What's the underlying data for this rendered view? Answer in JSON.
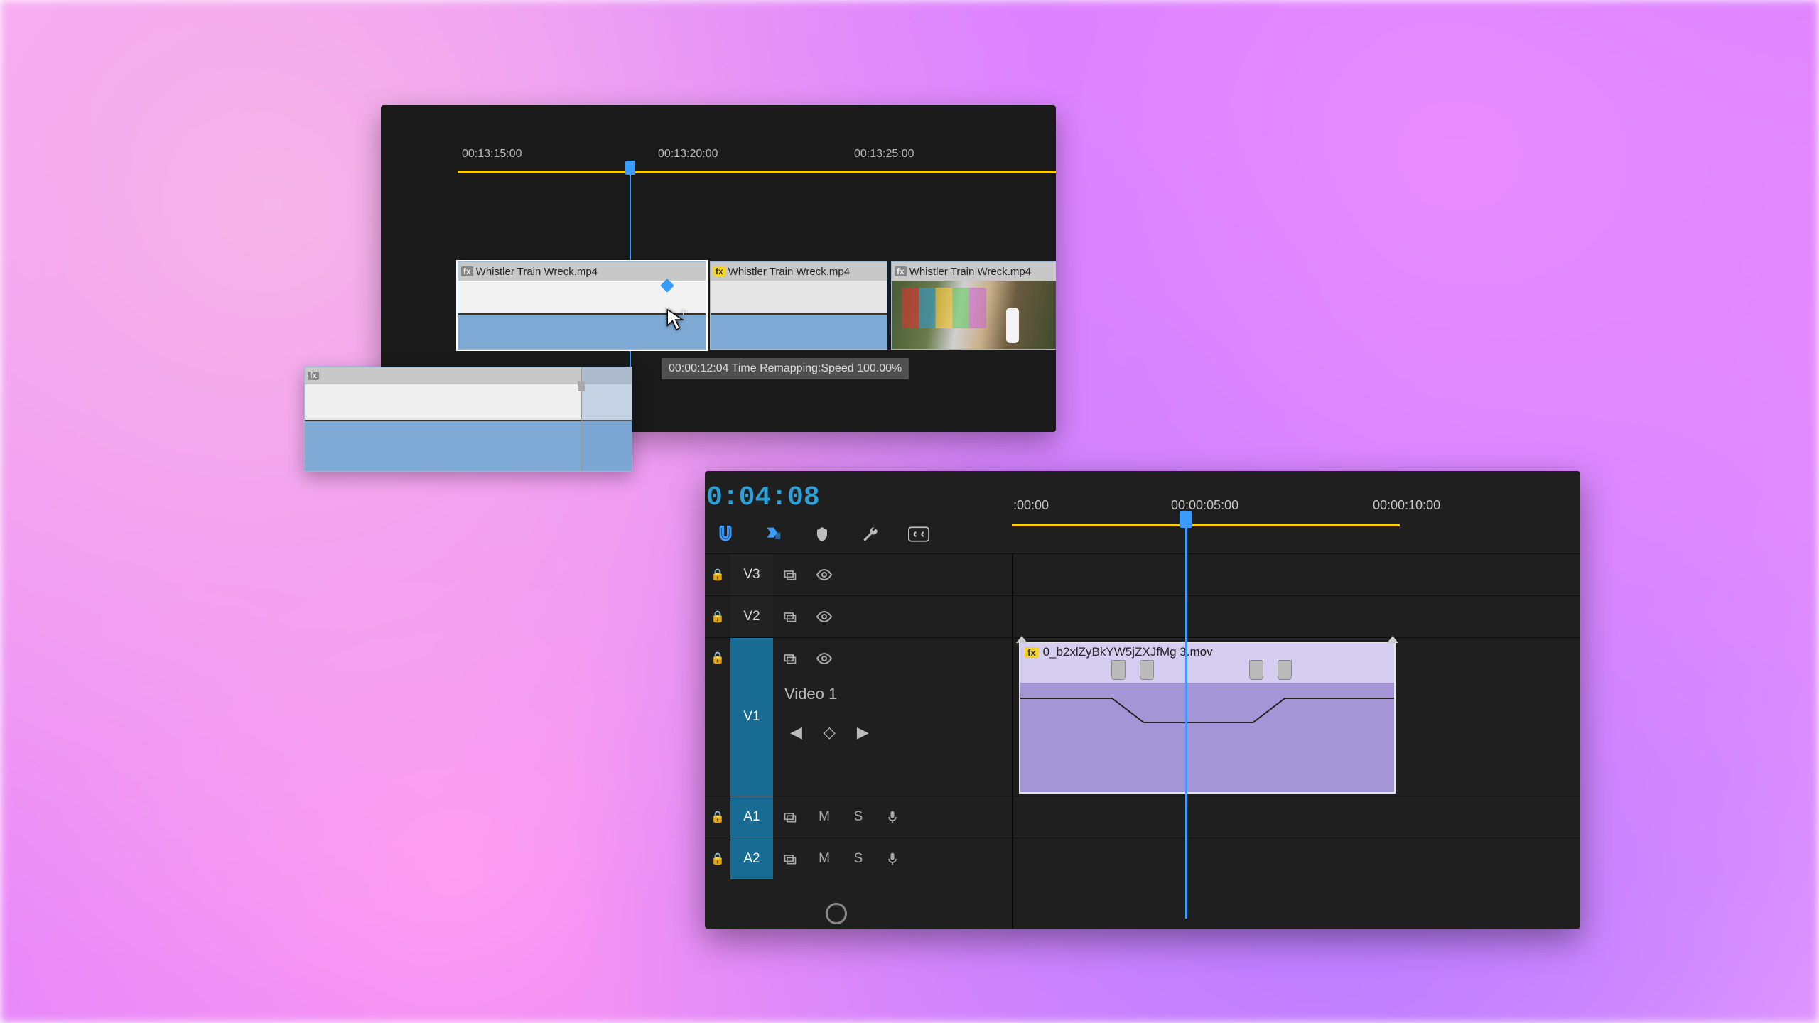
{
  "panelA": {
    "ruler": {
      "tc1": "00:13:15:00",
      "tc2": "00:13:20:00",
      "tc3": "00:13:25:00"
    },
    "clip1": {
      "label": "Whistler Train Wreck.mp4"
    },
    "clip2": {
      "label": "Whistler Train Wreck.mp4"
    },
    "clip3": {
      "label": "Whistler Train Wreck.mp4"
    },
    "tooltip": "00:00:12:04  Time Remapping:Speed  100.00%"
  },
  "panelB": {
    "timecode": "0:04:08",
    "ruler": {
      "tc1": ":00:00",
      "tc2": "00:00:05:00",
      "tc3": "00:00:10:00"
    },
    "tracks": {
      "v3": "V3",
      "v2": "V2",
      "v1": "V1",
      "v1_name": "Video 1",
      "a1": "A1",
      "a2": "A2",
      "mute": "M",
      "solo": "S"
    },
    "clip": {
      "label": "0_b2xlZyBkYW5jZXJfMg 3.mov"
    }
  }
}
